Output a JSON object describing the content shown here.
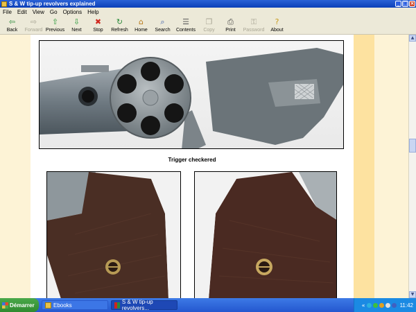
{
  "window": {
    "title": "S & W tip-up revolvers explained"
  },
  "menu": [
    "File",
    "Edit",
    "View",
    "Go",
    "Options",
    "Help"
  ],
  "toolbar": [
    {
      "label": "Back",
      "icon": "arrow-left-icon",
      "glyph": "⇦",
      "color": "#2a8a3a",
      "enabled": true
    },
    {
      "label": "Forward",
      "icon": "arrow-right-icon",
      "glyph": "⇨",
      "color": "#a8a594",
      "enabled": false
    },
    {
      "label": "Previous",
      "icon": "arrow-up-icon",
      "glyph": "⇧",
      "color": "#2a9a3a",
      "enabled": true
    },
    {
      "label": "Next",
      "icon": "arrow-down-icon",
      "glyph": "⇩",
      "color": "#2a9a3a",
      "enabled": true
    },
    {
      "label": "Stop",
      "icon": "stop-icon",
      "glyph": "✖",
      "color": "#d0261d",
      "enabled": true
    },
    {
      "label": "Refresh",
      "icon": "refresh-icon",
      "glyph": "↻",
      "color": "#2a8a3a",
      "enabled": true
    },
    {
      "label": "Home",
      "icon": "home-icon",
      "glyph": "⌂",
      "color": "#b87a1a",
      "enabled": true
    },
    {
      "label": "Search",
      "icon": "search-icon",
      "glyph": "⌕",
      "color": "#3a5ca8",
      "enabled": true
    },
    {
      "label": "Contents",
      "icon": "contents-icon",
      "glyph": "☰",
      "color": "#5a5a5a",
      "enabled": true
    },
    {
      "label": "Copy",
      "icon": "copy-icon",
      "glyph": "❐",
      "color": "#a8a594",
      "enabled": false
    },
    {
      "label": "Print",
      "icon": "print-icon",
      "glyph": "⎙",
      "color": "#4a4a4a",
      "enabled": true
    },
    {
      "label": "Password",
      "icon": "key-icon",
      "glyph": "⚿",
      "color": "#a8a594",
      "enabled": false
    },
    {
      "label": "About",
      "icon": "about-icon",
      "glyph": "?",
      "color": "#c89a1a",
      "enabled": true
    }
  ],
  "content": {
    "caption": "Trigger checkered"
  },
  "taskbar": {
    "start": "Démarrer",
    "tasks": [
      {
        "label": "Ebooks",
        "icon": "folder-icon"
      },
      {
        "label": "S & W tip-up revolvers...",
        "icon": "book-icon"
      }
    ],
    "clock": "11:42"
  },
  "colors": {
    "page_background": "#fdf5dc",
    "right_band": "#fde2a0",
    "titlebar": "#0b3fb8"
  }
}
